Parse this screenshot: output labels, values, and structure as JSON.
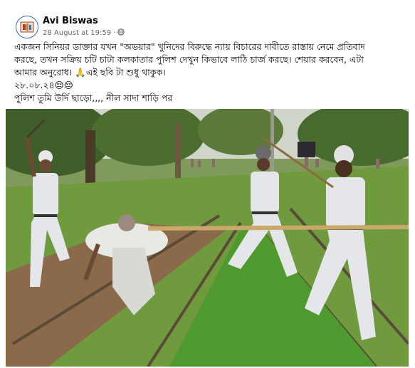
{
  "post": {
    "author": "Avi Biswas",
    "timestamp": "28 August at 19:59",
    "visibility_separator": "·",
    "lines": [
      "একজন সিনিয়র ডাক্তার যখন \"অভয়ার\" খুনিদের বিরুদ্ধে ন্যায় বিচারের দাবীতে রাস্তায় নেমে প্রতিবাদ",
      "করছে, তখন সক্রিয় চটি চাটা কলকাতার পুলিশ দেখুন কিভাবে লাঠি চার্জ করছে। শেয়ার করবেন, এটা",
      "আমার অনুরোধ। 🙏এই ছবি টা শুধু থাকুক।",
      "২৮.০৮.২৪😔😔",
      "পুলিশ তুমি উর্দি ছাড়ো,,,, নীল সাদা শাড়ি পর"
    ]
  },
  "icons": {
    "visibility": "globe-icon",
    "avatar": "profile-avatar-icon"
  },
  "colors": {
    "author": "#050505",
    "meta": "#65676b",
    "avatar_ring": "#2c6fb8"
  }
}
